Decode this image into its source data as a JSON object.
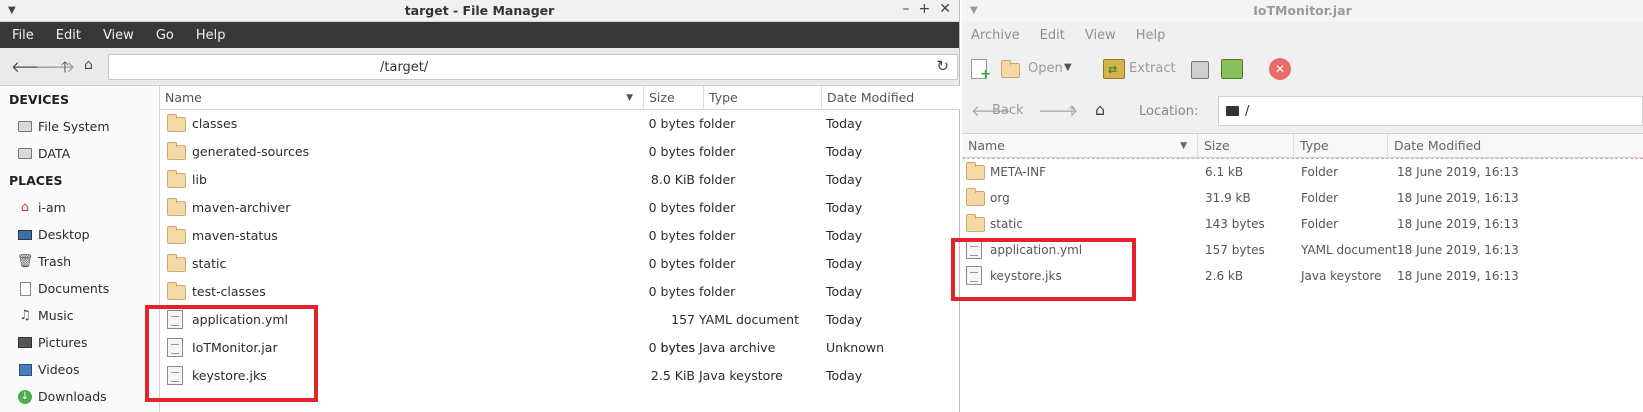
{
  "file_manager": {
    "title": "target - File Manager",
    "menu": [
      "File",
      "Edit",
      "View",
      "Go",
      "Help"
    ],
    "path": "/target/",
    "sidebar": {
      "devices_heading": "DEVICES",
      "devices": [
        "File System",
        "DATA"
      ],
      "places_heading": "PLACES",
      "places": [
        "i-am",
        "Desktop",
        "Trash",
        "Documents",
        "Music",
        "Pictures",
        "Videos",
        "Downloads"
      ]
    },
    "columns": {
      "name": "Name",
      "size": "Size",
      "type": "Type",
      "date": "Date Modified"
    },
    "rows": [
      {
        "name": "classes",
        "size": "0 bytes",
        "type": "folder",
        "date": "Today",
        "icon": "folder-icon"
      },
      {
        "name": "generated-sources",
        "size": "0 bytes",
        "type": "folder",
        "date": "Today",
        "icon": "folder-icon"
      },
      {
        "name": "lib",
        "size": "8.0 KiB",
        "type": "folder",
        "date": "Today",
        "icon": "folder-icon"
      },
      {
        "name": "maven-archiver",
        "size": "0 bytes",
        "type": "folder",
        "date": "Today",
        "icon": "folder-icon"
      },
      {
        "name": "maven-status",
        "size": "0 bytes",
        "type": "folder",
        "date": "Today",
        "icon": "folder-icon"
      },
      {
        "name": "static",
        "size": "0 bytes",
        "type": "folder",
        "date": "Today",
        "icon": "folder-icon"
      },
      {
        "name": "test-classes",
        "size": "0 bytes",
        "type": "folder",
        "date": "Today",
        "icon": "folder-icon"
      },
      {
        "name": "application.yml",
        "size": "157 bytes",
        "type": "YAML document",
        "date": "Today",
        "icon": "file-icon"
      },
      {
        "name": "IoTMonitor.jar",
        "size": "0 bytes",
        "type": "Java archive",
        "date": "Unknown",
        "icon": "file-icon"
      },
      {
        "name": "keystore.jks",
        "size": "2.5 KiB",
        "type": "Java keystore",
        "date": "Today",
        "icon": "file-icon"
      }
    ]
  },
  "archive_manager": {
    "title": "IoTMonitor.jar",
    "menu": [
      "Archive",
      "Edit",
      "View",
      "Help"
    ],
    "toolbar": {
      "open": "Open",
      "extract": "Extract",
      "back": "Back",
      "location_label": "Location:"
    },
    "location": "/",
    "columns": {
      "name": "Name",
      "size": "Size",
      "type": "Type",
      "date": "Date Modified"
    },
    "rows": [
      {
        "name": "META-INF",
        "size": "6.1 kB",
        "type": "Folder",
        "date": "18 June 2019, 16:13",
        "icon": "folder-icon"
      },
      {
        "name": "org",
        "size": "31.9 kB",
        "type": "Folder",
        "date": "18 June 2019, 16:13",
        "icon": "folder-icon"
      },
      {
        "name": "static",
        "size": "143 bytes",
        "type": "Folder",
        "date": "18 June 2019, 16:13",
        "icon": "folder-icon"
      },
      {
        "name": "application.yml",
        "size": "157 bytes",
        "type": "YAML document",
        "date": "18 June 2019, 16:13",
        "icon": "file-icon"
      },
      {
        "name": "keystore.jks",
        "size": "2.6 kB",
        "type": "Java keystore",
        "date": "18 June 2019, 16:13",
        "icon": "file-icon"
      }
    ]
  },
  "colors": {
    "highlight_box": "#e3222b",
    "menubar_dark": "#383838",
    "folder": "#f4d9a6"
  }
}
